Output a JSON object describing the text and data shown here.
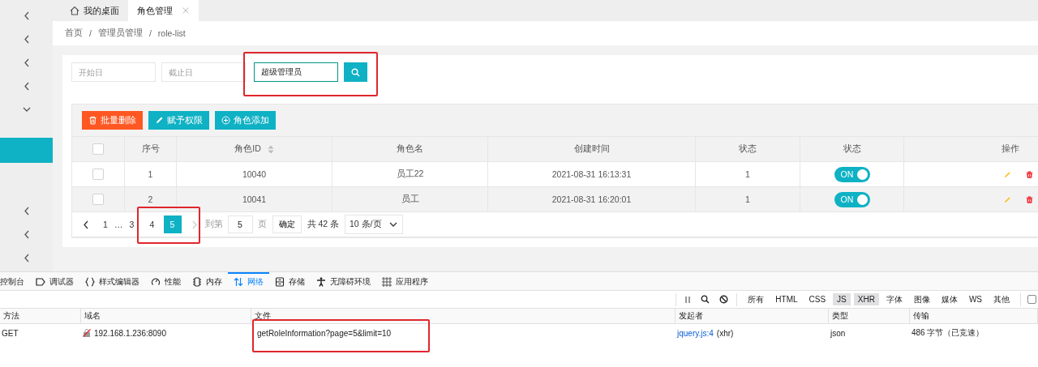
{
  "sidebar": {
    "items": [
      {
        "kind": "group",
        "expanded": false
      },
      {
        "kind": "group",
        "expanded": false
      },
      {
        "kind": "group",
        "expanded": false
      },
      {
        "kind": "group",
        "expanded": false
      },
      {
        "kind": "group",
        "expanded": true
      },
      {
        "kind": "entry",
        "selected": true
      },
      {
        "kind": "group",
        "expanded": false
      },
      {
        "kind": "group",
        "expanded": false
      },
      {
        "kind": "group",
        "expanded": false
      }
    ]
  },
  "tabs": [
    {
      "label": "我的桌面",
      "kind": "home",
      "selected": false,
      "closable": false
    },
    {
      "label": "角色管理",
      "kind": "page",
      "selected": true,
      "closable": true
    }
  ],
  "breadcrumb": [
    {
      "label": "首页",
      "separator": "/"
    },
    {
      "label": "管理员管理",
      "separator": "/"
    },
    {
      "label": "role-list"
    }
  ],
  "search": {
    "start_date": {
      "placeholder": "开始日"
    },
    "end_date": {
      "placeholder": "截止日"
    },
    "keyword": {
      "value": "超级管理员",
      "focused": true
    },
    "highlighted": true
  },
  "toolbar": [
    {
      "label": "批量删除",
      "kind": "delete"
    },
    {
      "label": "赋予权限",
      "kind": "edit"
    },
    {
      "label": "角色添加",
      "kind": "add"
    }
  ],
  "table": {
    "select_all": {
      "checked": false
    },
    "columns": [
      {
        "kind": "text",
        "label": "序号",
        "sortable": false
      },
      {
        "kind": "text",
        "label": "角色ID",
        "sortable": true
      },
      {
        "kind": "text",
        "label": "角色名",
        "sortable": false
      },
      {
        "kind": "text",
        "label": "创建时间",
        "sortable": false
      },
      {
        "kind": "text",
        "label": "状态",
        "sortable": false
      },
      {
        "kind": "text",
        "label": "状态",
        "sortable": false
      },
      {
        "kind": "text",
        "label": "操作",
        "sortable": false
      }
    ],
    "rows": [
      {
        "checked": false,
        "hovered": false,
        "cells": [
          "1",
          "10040",
          "员工22",
          "2021-08-31 16:13:31",
          "1"
        ],
        "switch": {
          "label": "ON",
          "on": true
        }
      },
      {
        "checked": false,
        "hovered": true,
        "cells": [
          "2",
          "10041",
          "员工",
          "2021-08-31 16:20:01",
          "1"
        ],
        "switch": {
          "label": "ON",
          "on": true
        }
      }
    ]
  },
  "pagination": {
    "highlighted": true,
    "prev_disabled": false,
    "next_disabled": true,
    "pages": [
      {
        "kind": "page",
        "label": "1",
        "selected": false
      },
      {
        "kind": "ellipsis",
        "label": "…"
      },
      {
        "kind": "page",
        "label": "3",
        "selected": false
      },
      {
        "kind": "page",
        "label": "4",
        "selected": false
      },
      {
        "kind": "page",
        "label": "5",
        "selected": true
      }
    ],
    "jump_label": "到第",
    "jump_value": "5",
    "jump_unit": "页",
    "confirm": "确定",
    "total": "共 42 条",
    "page_size": "10 条/页"
  },
  "devtools": {
    "tabs": [
      {
        "label": "控制台",
        "kind": "console",
        "selected": false
      },
      {
        "label": "调试器",
        "kind": "debugger",
        "selected": false
      },
      {
        "label": "样式编辑器",
        "kind": "style",
        "selected": false
      },
      {
        "label": "性能",
        "kind": "performance",
        "selected": false
      },
      {
        "label": "内存",
        "kind": "memory",
        "selected": false
      },
      {
        "label": "网络",
        "kind": "network",
        "selected": true
      },
      {
        "label": "存储",
        "kind": "storage",
        "selected": false
      },
      {
        "label": "无障碍环境",
        "kind": "accessibility",
        "selected": false
      },
      {
        "label": "应用程序",
        "kind": "application",
        "selected": false
      }
    ],
    "filters": [
      {
        "label": "所有",
        "selected": false
      },
      {
        "label": "HTML",
        "selected": false
      },
      {
        "label": "CSS",
        "selected": false
      },
      {
        "label": "JS",
        "selected": true
      },
      {
        "label": "XHR",
        "selected": true
      },
      {
        "label": "字体",
        "selected": false
      },
      {
        "label": "图像",
        "selected": false
      },
      {
        "label": "媒体",
        "selected": false
      },
      {
        "label": "WS",
        "selected": false
      },
      {
        "label": "其他",
        "selected": false
      }
    ],
    "disable_cache": {
      "checked": false
    },
    "columns": [
      "方法",
      "域名",
      "文件",
      "发起者",
      "类型",
      "传输"
    ],
    "requests": [
      {
        "method": "GET",
        "domain": "192.168.1.236:8090",
        "insecure": true,
        "file": "getRoleInformation?page=5&limit=10",
        "file_highlighted": true,
        "initiator": "jquery.js:4",
        "initiator_kind": "(xhr)",
        "type": "json",
        "transferred": "486 字节（已竞速）"
      }
    ]
  }
}
